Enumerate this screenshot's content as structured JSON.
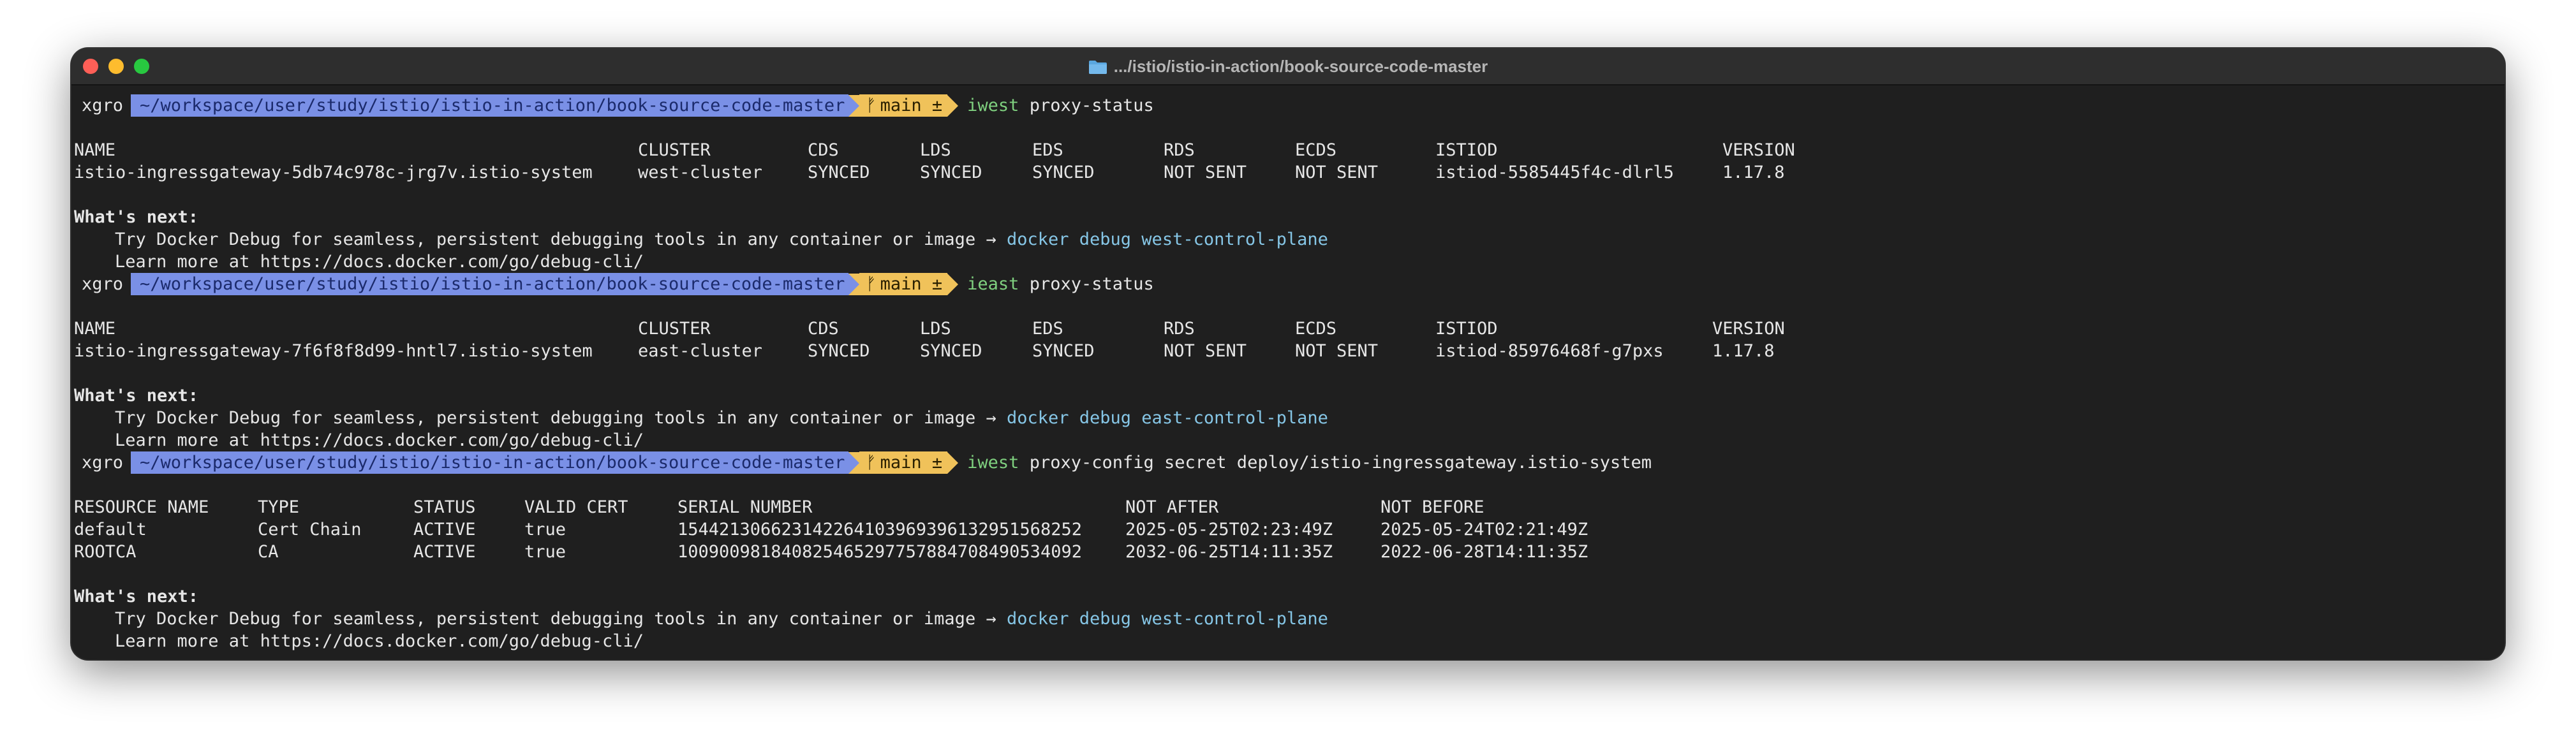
{
  "window": {
    "title": ".../istio/istio-in-action/book-source-code-master"
  },
  "prompt": {
    "user": "xgro",
    "path": "~/workspace/user/study/istio/istio-in-action/book-source-code-master",
    "branch_glyph": "ᚠ",
    "branch": "main ±"
  },
  "blocks": [
    {
      "command_bin": "iwest",
      "command_args": "proxy-status",
      "table": {
        "headers": [
          "NAME",
          "CLUSTER",
          "CDS",
          "LDS",
          "EDS",
          "RDS",
          "ECDS",
          "ISTIOD",
          "VERSION"
        ],
        "rows": [
          [
            "istio-ingressgateway-5db74c978c-jrg7v.istio-system",
            "west-cluster",
            "SYNCED",
            "SYNCED",
            "SYNCED",
            "NOT SENT",
            "NOT SENT",
            "istiod-5585445f4c-dlrl5",
            "1.17.8"
          ]
        ]
      },
      "next_title": "What's next:",
      "next_line1": "Try Docker Debug for seamless, persistent debugging tools in any container or image →",
      "next_cmd": "docker debug west-control-plane",
      "next_line2": "Learn more at https://docs.docker.com/go/debug-cli/"
    },
    {
      "command_bin": "ieast",
      "command_args": "proxy-status",
      "table": {
        "headers": [
          "NAME",
          "CLUSTER",
          "CDS",
          "LDS",
          "EDS",
          "RDS",
          "ECDS",
          "ISTIOD",
          "VERSION"
        ],
        "rows": [
          [
            "istio-ingressgateway-7f6f8f8d99-hntl7.istio-system",
            "east-cluster",
            "SYNCED",
            "SYNCED",
            "SYNCED",
            "NOT SENT",
            "NOT SENT",
            "istiod-85976468f-g7pxs",
            "1.17.8"
          ]
        ]
      },
      "next_title": "What's next:",
      "next_line1": "Try Docker Debug for seamless, persistent debugging tools in any container or image →",
      "next_cmd": "docker debug east-control-plane",
      "next_line2": "Learn more at https://docs.docker.com/go/debug-cli/"
    },
    {
      "command_bin": "iwest",
      "command_args": "proxy-config secret deploy/istio-ingressgateway.istio-system",
      "table": {
        "headers": [
          "RESOURCE NAME",
          "TYPE",
          "STATUS",
          "VALID CERT",
          "SERIAL NUMBER",
          "NOT AFTER",
          "NOT BEFORE"
        ],
        "rows": [
          [
            "default",
            "Cert Chain",
            "ACTIVE",
            "true",
            "154421306623142264103969396132951568252",
            "2025-05-25T02:23:49Z",
            "2025-05-24T02:21:49Z"
          ],
          [
            "ROOTCA",
            "CA",
            "ACTIVE",
            "true",
            "100900981840825465297757884708490534092",
            "2032-06-25T14:11:35Z",
            "2022-06-28T14:11:35Z"
          ]
        ]
      },
      "next_title": "What's next:",
      "next_line1": "Try Docker Debug for seamless, persistent debugging tools in any container or image →",
      "next_cmd": "docker debug west-control-plane",
      "next_line2": "Learn more at https://docs.docker.com/go/debug-cli/"
    }
  ],
  "colors": {
    "terminal_bg": "#1f1f1f",
    "path_segment": "#7a90e6",
    "git_segment": "#f0c25a",
    "command": "#7fd07f",
    "docker_cmd": "#86c6e6"
  }
}
